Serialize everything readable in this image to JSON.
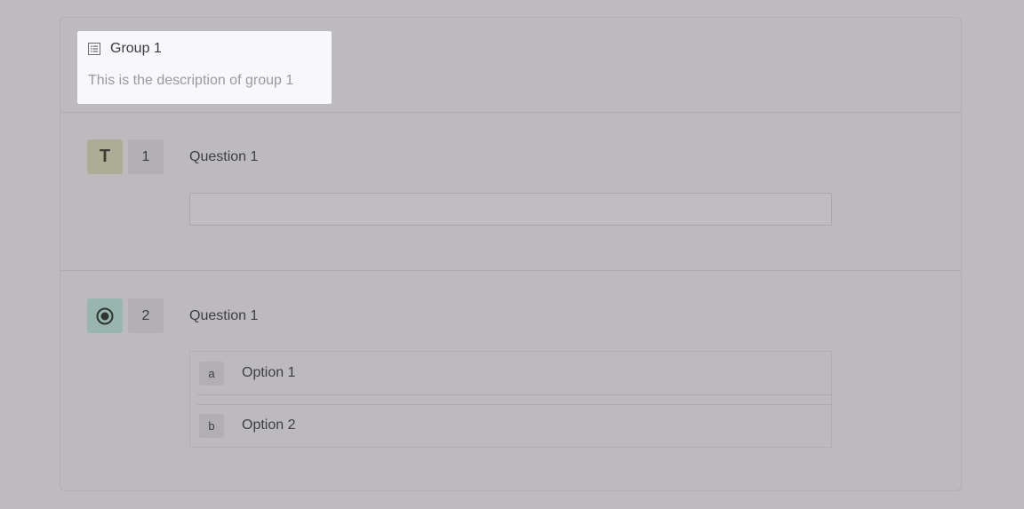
{
  "group": {
    "title": "Group 1",
    "description": "This is the description of group 1",
    "icon": "list-icon"
  },
  "questions": [
    {
      "type_icon": "T",
      "type": "text",
      "number": "1",
      "label": "Question 1",
      "input_value": ""
    },
    {
      "type_icon": "radio-icon",
      "type": "single-choice",
      "number": "2",
      "label": "Question 1",
      "options": [
        {
          "key": "a",
          "label": "Option 1"
        },
        {
          "key": "b",
          "label": "Option 2"
        }
      ]
    }
  ],
  "colors": {
    "text_type_badge": "#adad95",
    "radio_type_badge": "#98b5ae",
    "highlight": "#f8f8fa"
  }
}
